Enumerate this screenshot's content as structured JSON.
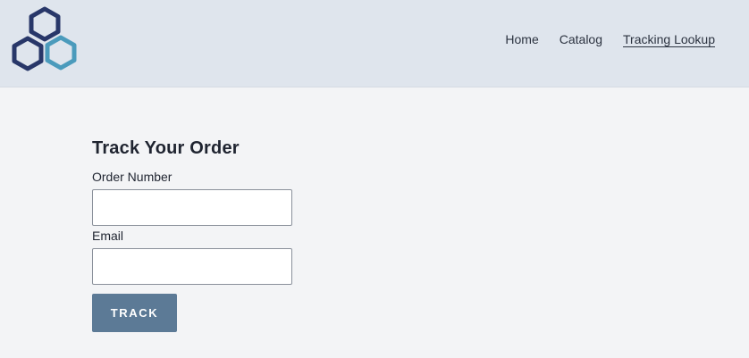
{
  "brand": {
    "logo_icon": "hexagon-cluster-logo",
    "colors": {
      "dark_hex": "#283769",
      "light_hex": "#4b9bbc"
    }
  },
  "nav": {
    "items": [
      {
        "label": "Home"
      },
      {
        "label": "Catalog"
      },
      {
        "label": "Tracking Lookup"
      }
    ],
    "active_index": 2
  },
  "form": {
    "title": "Track Your Order",
    "order_number_label": "Order Number",
    "order_number_value": "",
    "email_label": "Email",
    "email_value": "",
    "submit_label": "TRACK"
  },
  "colors": {
    "header_bg": "#dfe5ed",
    "page_bg": "#f3f4f6",
    "button_bg": "#5c7a96"
  }
}
